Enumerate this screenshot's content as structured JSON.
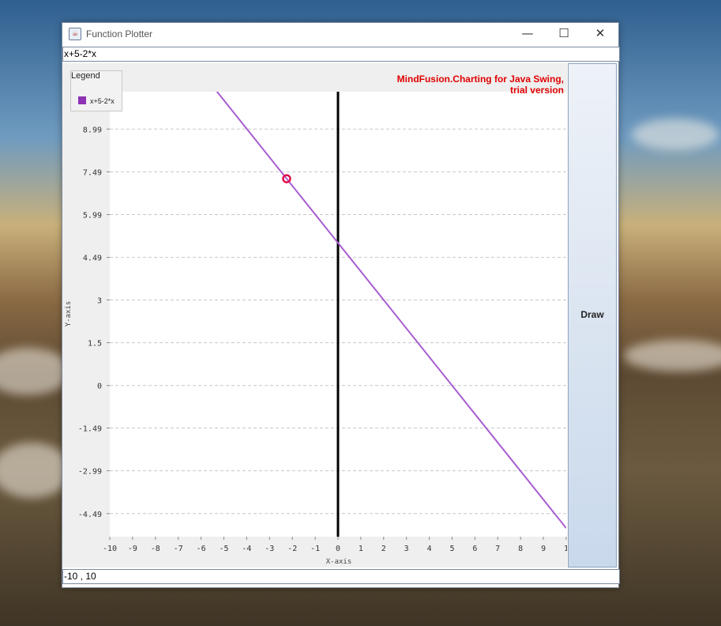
{
  "window": {
    "title": "Function Plotter",
    "icon": "java-app-icon",
    "controls": {
      "minimize": "—",
      "maximize": "☐",
      "close": "✕"
    }
  },
  "function_input": {
    "value": "x+5-2*x"
  },
  "range_input": {
    "value": "-10 , 10"
  },
  "draw_button": {
    "label": "Draw"
  },
  "watermark": {
    "line1": "MindFusion.Charting for Java Swing,",
    "line2": "trial version"
  },
  "legend": {
    "title": "Legend",
    "entries": [
      {
        "label": "x+5-2*x",
        "color": "#8e33b5"
      }
    ]
  },
  "chart_data": {
    "type": "line",
    "xlabel": "X-axis",
    "ylabel": "Y-axis",
    "xlim": [
      -10,
      10
    ],
    "ylim": [
      -5.3,
      10.3
    ],
    "x_ticks": [
      "-10",
      "-9",
      "-8",
      "-7",
      "-6",
      "-5",
      "-4",
      "-3",
      "-2",
      "-1",
      "0",
      "1",
      "2",
      "3",
      "4",
      "5",
      "6",
      "7",
      "8",
      "9",
      "1"
    ],
    "y_ticks": [
      {
        "value": 8.99,
        "label": "8.99"
      },
      {
        "value": 7.49,
        "label": "7.49"
      },
      {
        "value": 5.99,
        "label": "5.99"
      },
      {
        "value": 4.49,
        "label": "4.49"
      },
      {
        "value": 3,
        "label": "3"
      },
      {
        "value": 1.5,
        "label": "1.5"
      },
      {
        "value": 0,
        "label": "0"
      },
      {
        "value": -1.49,
        "label": "-1.49"
      },
      {
        "value": -2.99,
        "label": "-2.99"
      },
      {
        "value": -4.49,
        "label": "-4.49"
      }
    ],
    "grid": true,
    "legend_position": "top-left",
    "series": [
      {
        "name": "x+5-2*x",
        "color": "#a85cd0",
        "x": [
          -10,
          10
        ],
        "y": [
          15,
          -5
        ]
      }
    ],
    "marker": {
      "x": -2.25,
      "y": 7.25,
      "color": "#e0104a"
    },
    "zero_line_color": "#000000"
  }
}
